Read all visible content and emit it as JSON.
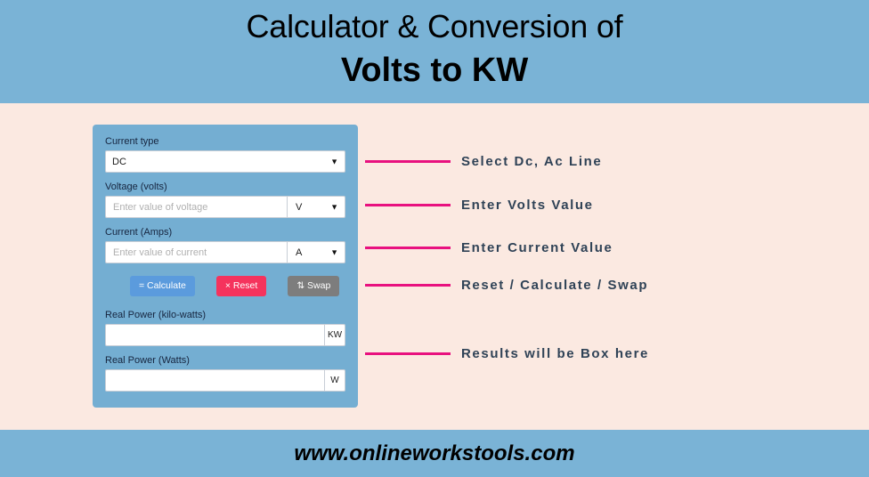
{
  "header": {
    "line1": "Calculator & Conversion of",
    "line2": "Volts to KW"
  },
  "calculator": {
    "current_type": {
      "label": "Current type",
      "value": "DC",
      "chevron": "chevron-down"
    },
    "voltage": {
      "label": "Voltage (volts)",
      "placeholder": "Enter value of voltage",
      "value": "",
      "unit": "V",
      "chevron": "chevron-down"
    },
    "current": {
      "label": "Current (Amps)",
      "placeholder": "Enter value of current",
      "value": "",
      "unit": "A",
      "chevron": "chevron-down"
    },
    "buttons": {
      "calculate": "= Calculate",
      "reset": "× Reset",
      "swap": "⇅ Swap"
    },
    "real_power_kw": {
      "label": "Real Power (kilo-watts)",
      "value": "",
      "unit": "KW"
    },
    "real_power_w": {
      "label": "Real Power (Watts)",
      "value": "",
      "unit": "W"
    }
  },
  "annotations": [
    {
      "text": "Select Dc, Ac Line"
    },
    {
      "text": "Enter Volts Value"
    },
    {
      "text": "Enter Current Value"
    },
    {
      "text": "Reset / Calculate / Swap"
    },
    {
      "text": "Results will be Box here"
    }
  ],
  "footer": {
    "url": "www.onlineworkstools.com"
  },
  "colors": {
    "band": "#7ab3d6",
    "page_bg": "#fbe9e1",
    "card_bg": "#74aed2",
    "leader_line": "#e8117f",
    "annotation_text": "#2f4256",
    "btn_calculate": "#5b9bdd",
    "btn_reset": "#f5335d",
    "btn_swap": "#7d7d7d"
  }
}
